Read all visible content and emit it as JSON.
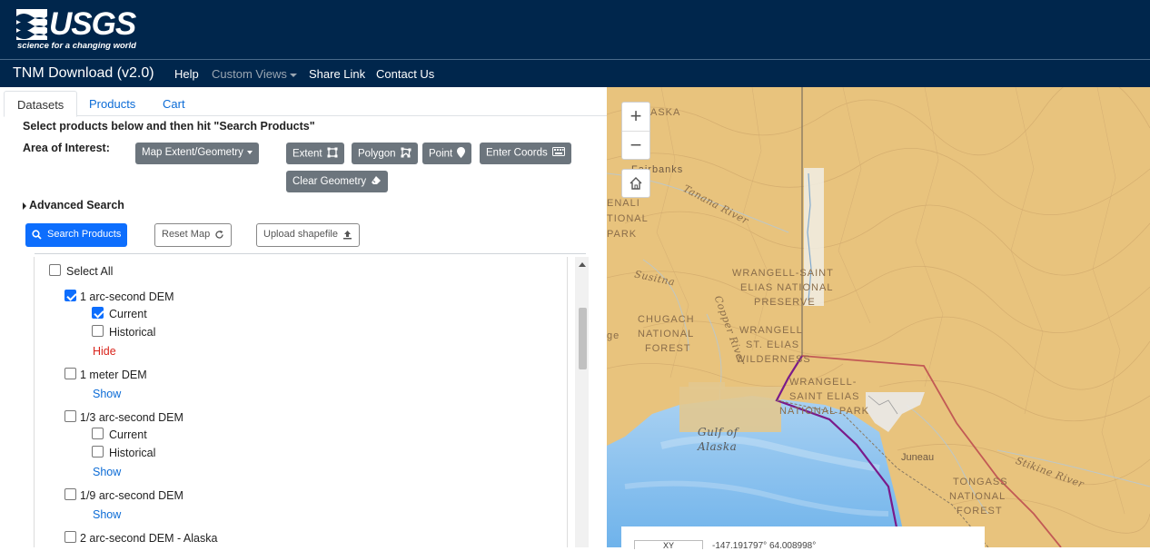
{
  "header": {
    "logo_text": "USGS",
    "logo_tagline": "science for a changing world",
    "brand": "TNM Download (v2.0)",
    "nav": [
      {
        "label": "Help"
      },
      {
        "label": "Custom Views"
      },
      {
        "label": "Share Link"
      },
      {
        "label": "Contact Us"
      }
    ]
  },
  "tabs": [
    {
      "label": "Datasets"
    },
    {
      "label": "Products"
    },
    {
      "label": "Cart"
    }
  ],
  "instructions": "Select products below and then hit \"Search Products\"",
  "aoi": {
    "label": "Area of Interest:",
    "dropdown": "Map Extent/Geometry",
    "extent": "Extent",
    "polygon": "Polygon",
    "point": "Point",
    "coords": "Enter Coords",
    "clear": "Clear Geometry"
  },
  "advanced_search": "Advanced Search",
  "actions": {
    "search": "Search Products",
    "reset": "Reset Map",
    "upload": "Upload shapefile"
  },
  "datasets": {
    "select_all": "Select All",
    "items": [
      {
        "label": "1 arc-second DEM",
        "checked": true,
        "sub": [
          {
            "label": "Current",
            "checked": true
          },
          {
            "label": "Historical",
            "checked": false
          }
        ],
        "toggle": "Hide"
      },
      {
        "label": "1 meter DEM",
        "checked": false,
        "toggle": "Show"
      },
      {
        "label": "1/3 arc-second DEM",
        "checked": false,
        "sub": [
          {
            "label": "Current",
            "checked": false
          },
          {
            "label": "Historical",
            "checked": false
          }
        ],
        "toggle": "Show"
      },
      {
        "label": "1/9 arc-second DEM",
        "checked": false,
        "toggle": "Show"
      },
      {
        "label": "2 arc-second DEM - Alaska",
        "checked": false
      }
    ]
  },
  "map": {
    "labels": {
      "alaska": "ASKA",
      "fairbanks": "Fairbanks",
      "tanana": "Tanana River",
      "denali1": "ENALI",
      "denali2": "TIONAL",
      "denali3": "PARK",
      "susitna": "Susitna",
      "wrangell1": "WRANGELL-SAINT",
      "wrangell2": "ELIAS NATIONAL",
      "wrangell3": "PRESERVE",
      "chugach1": "CHUGACH",
      "chugach2": "NATIONAL",
      "chugach3": "FOREST",
      "ge": "ge",
      "copper": "Copper River",
      "wse1": "WRANGELL",
      "wse2": "ST. ELIAS",
      "wse3": "WILDERNESS",
      "wsnp1": "WRANGELL-",
      "wsnp2": "SAINT ELIAS",
      "wsnp3": "NATIONAL PARK",
      "gulf1": "Gulf of",
      "gulf2": "Alaska",
      "juneau": "Juneau",
      "tongass1": "TONGASS",
      "tongass2": "NATIONAL",
      "tongass3": "FOREST",
      "stikine": "Stikine River"
    },
    "coord_label": "XY",
    "coord_value": "-147.191797° 64.008998°"
  },
  "colors": {
    "header_bg": "#00264c",
    "primary": "#0d6efd",
    "secondary": "#6c757d",
    "hide": "#d9241c"
  }
}
